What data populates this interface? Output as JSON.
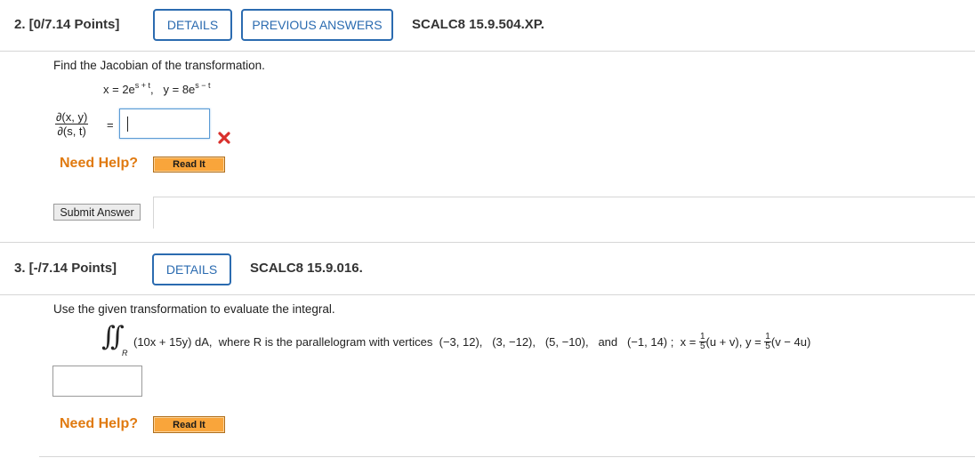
{
  "q2": {
    "number_label": "2. [0/7.14 Points]",
    "details_label": "DETAILS",
    "prev_answers_label": "PREVIOUS ANSWERS",
    "code": "SCALC8 15.9.504.XP.",
    "prompt": "Find the Jacobian of the transformation.",
    "eq_x": "x = 2e",
    "eq_x_exp": "s + t",
    "eq_sep": ",",
    "eq_y": "y = 8e",
    "eq_y_exp": "s − t",
    "jac_num": "∂(x, y)",
    "jac_den": "∂(s, t)",
    "equals": "=",
    "answer_value": "",
    "status_icon": "incorrect-x-icon",
    "need_help": "Need Help?",
    "read_it": "Read It",
    "submit": "Submit Answer"
  },
  "q3": {
    "number_label": "3. [-/7.14 Points]",
    "details_label": "DETAILS",
    "code": "SCALC8 15.9.016.",
    "prompt": "Use the given transformation to evaluate the integral.",
    "integral_symbol": "∬",
    "region": "R",
    "integrand": "(10x + 15y) dA,",
    "where_text": "where R is the parallelogram with vertices",
    "vertices": "(−3, 12),   (3, −12),   (5, −10),   and   (−1, 14) ;",
    "x_eq": "x =",
    "frac_num": "1",
    "frac_den": "5",
    "x_rest": "(u + v),",
    "y_eq": "y =",
    "y_rest": "(v − 4u)",
    "answer_value": "",
    "need_help": "Need Help?",
    "read_it": "Read It"
  },
  "colors": {
    "accent_blue": "#2b6bb0",
    "help_orange": "#e07a10",
    "read_it_orange": "#f9a53b",
    "error_red": "#d9302c",
    "focus_border": "#5b9bd5"
  }
}
